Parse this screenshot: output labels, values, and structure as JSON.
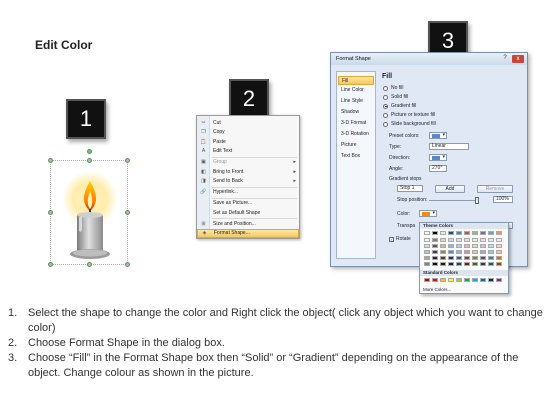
{
  "title": "Edit Color",
  "badges": [
    "1",
    "2",
    "3"
  ],
  "context_menu": {
    "items": [
      {
        "label": "Cut",
        "icon": "scissors-icon",
        "glyph": "✂",
        "disabled": false,
        "submenu": false
      },
      {
        "label": "Copy",
        "icon": "copy-icon",
        "glyph": "❐",
        "disabled": false,
        "submenu": false
      },
      {
        "label": "Paste",
        "icon": "paste-icon",
        "glyph": "📋",
        "disabled": false,
        "submenu": false
      },
      {
        "label": "Edit Text",
        "icon": "edit-text-icon",
        "glyph": "A",
        "disabled": false,
        "submenu": false
      },
      {
        "label": "Group",
        "icon": "group-icon",
        "glyph": "▣",
        "disabled": true,
        "submenu": true
      },
      {
        "label": "Bring to Front",
        "icon": "bring-front-icon",
        "glyph": "◧",
        "disabled": false,
        "submenu": true
      },
      {
        "label": "Send to Back",
        "icon": "send-back-icon",
        "glyph": "◨",
        "disabled": false,
        "submenu": true
      },
      {
        "label": "Hyperlink...",
        "icon": "hyperlink-icon",
        "glyph": "🔗",
        "disabled": false,
        "submenu": false
      },
      {
        "label": "Save as Picture...",
        "icon": "",
        "glyph": "",
        "disabled": false,
        "submenu": false
      },
      {
        "label": "Set as Default Shape",
        "icon": "",
        "glyph": "",
        "disabled": false,
        "submenu": false
      },
      {
        "label": "Size and Position...",
        "icon": "size-position-icon",
        "glyph": "⊞",
        "disabled": false,
        "submenu": false
      },
      {
        "label": "Format Shape...",
        "icon": "format-shape-icon",
        "glyph": "◈",
        "disabled": false,
        "submenu": false,
        "active": true
      }
    ]
  },
  "dialog": {
    "title": "Format Shape",
    "help": "?",
    "close": "x",
    "nav": [
      "Fill",
      "Line Color",
      "Line Style",
      "Shadow",
      "3-D Format",
      "3-D Rotation",
      "Picture",
      "Text Box"
    ],
    "fill_heading": "Fill",
    "options": [
      "No fill",
      "Solid fill",
      "Gradient fill",
      "Picture or texture fill",
      "Slide background fill"
    ],
    "selected_option": "Gradient fill",
    "preset_colors_label": "Preset colors:",
    "type_label": "Type:",
    "type_value": "Linear",
    "direction_label": "Direction:",
    "angle_label": "Angle:",
    "angle_value": "270°",
    "gradient_stops_label": "Gradient stops",
    "stop_value": "Stop 1",
    "add_button": "Add",
    "remove_button": "Remove",
    "stop_position_label": "Stop position:",
    "stop_position_value": "100%",
    "color_label": "Color:",
    "transparency_label": "Transpa",
    "transparency_value": "0%",
    "rotate_label": "Rotate"
  },
  "color_popup": {
    "theme_label": "Theme Colors",
    "standard_label": "Standard Colors",
    "more_label": "More Colors...",
    "theme_top": [
      "#ffffff",
      "#000000",
      "#eeece1",
      "#1f497d",
      "#4f81bd",
      "#c0504d",
      "#9bbb59",
      "#8064a2",
      "#4bacc6",
      "#f79646"
    ],
    "theme_shade_rows": [
      [
        "#f2f2f2",
        "#7f7f7f",
        "#ddd9c3",
        "#c6d9f0",
        "#dbe5f1",
        "#f2dcdb",
        "#ebf1dd",
        "#e5e0ec",
        "#dbeef3",
        "#fdeada"
      ],
      [
        "#d8d8d8",
        "#595959",
        "#c4bd97",
        "#8db3e2",
        "#b8cce4",
        "#e5b9b7",
        "#d7e3bc",
        "#ccc1d9",
        "#b7dde8",
        "#fbd5b5"
      ],
      [
        "#bfbfbf",
        "#3f3f3f",
        "#938953",
        "#548dd4",
        "#95b3d7",
        "#d99694",
        "#c3d69b",
        "#b2a2c7",
        "#92cddc",
        "#fac08f"
      ],
      [
        "#a5a5a5",
        "#262626",
        "#494429",
        "#17365d",
        "#366092",
        "#953734",
        "#76923c",
        "#5f497a",
        "#31859b",
        "#e36c09"
      ],
      [
        "#7f7f7f",
        "#0c0c0c",
        "#1d1b10",
        "#0f243e",
        "#244061",
        "#632423",
        "#4f6128",
        "#3f3151",
        "#205867",
        "#974806"
      ]
    ],
    "standard": [
      "#c00000",
      "#ff0000",
      "#ffc000",
      "#ffff00",
      "#92d050",
      "#00b050",
      "#00b0f0",
      "#0070c0",
      "#002060",
      "#7030a0"
    ]
  },
  "instructions": [
    {
      "num": "1.",
      "text": "Select the shape to change the color and Right click the object( click any object which you want to change color)"
    },
    {
      "num": "2.",
      "text": "Choose Format Shape in the dialog box."
    },
    {
      "num": "3.",
      "text": "Choose “Fill” in the Format Shape box then “Solid” or “Gradient” depending on the appearance of the object. Change colour as shown in the picture."
    }
  ]
}
